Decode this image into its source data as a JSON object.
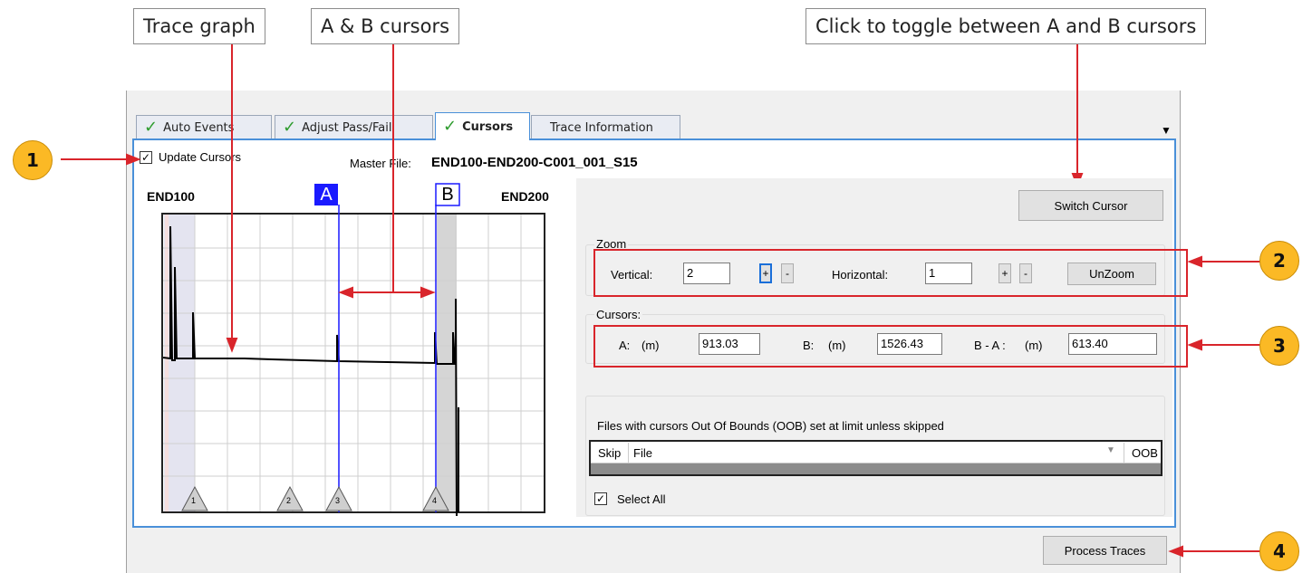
{
  "callouts": {
    "trace_graph": "Trace graph",
    "ab_cursors": "A & B cursors",
    "toggle": "Click to toggle between A and B cursors"
  },
  "badges": [
    "1",
    "2",
    "3",
    "4"
  ],
  "tabs": [
    {
      "label": "Auto Events",
      "checked": true
    },
    {
      "label": "Adjust Pass/Fail",
      "checked": true
    },
    {
      "label": "Cursors",
      "checked": true,
      "active": true
    },
    {
      "label": "Trace Information",
      "checked": false
    }
  ],
  "header": {
    "update_cursors_label": "Update Cursors",
    "update_cursors_checked": true,
    "master_file_label": "Master File:",
    "master_file_value": "END100-END200-C001_001_S15"
  },
  "graph": {
    "left_end": "END100",
    "right_end": "END200",
    "cursor_a_label": "A",
    "cursor_b_label": "B",
    "events": [
      "1",
      "2",
      "3",
      "4"
    ]
  },
  "switch_cursor_label": "Switch Cursor",
  "zoom": {
    "group_label": "Zoom",
    "vertical_label": "Vertical:",
    "vertical_value": "2",
    "horizontal_label": "Horizontal:",
    "horizontal_value": "1",
    "plus": "+",
    "minus": "-",
    "unzoom_label": "UnZoom"
  },
  "cursors": {
    "group_label": "Cursors:",
    "a_label": "A:",
    "a_unit": "(m)",
    "a_value": "913.03",
    "b_label": "B:",
    "b_unit": "(m)",
    "b_value": "1526.43",
    "diff_label": "B - A :",
    "diff_unit": "(m)",
    "diff_value": "613.40"
  },
  "oob": {
    "description": "Files with cursors Out Of Bounds (OOB) set at limit unless skipped",
    "columns": [
      "Skip",
      "File",
      "OOB"
    ],
    "select_all_label": "Select All",
    "select_all_checked": true
  },
  "process_traces_label": "Process Traces",
  "colors": {
    "accent_blue": "#4a90d9",
    "cursor_blue": "#1a1aff",
    "callout_red": "#d9252b",
    "badge_orange": "#fbb925",
    "tab_check_green": "#2e9c2e"
  }
}
